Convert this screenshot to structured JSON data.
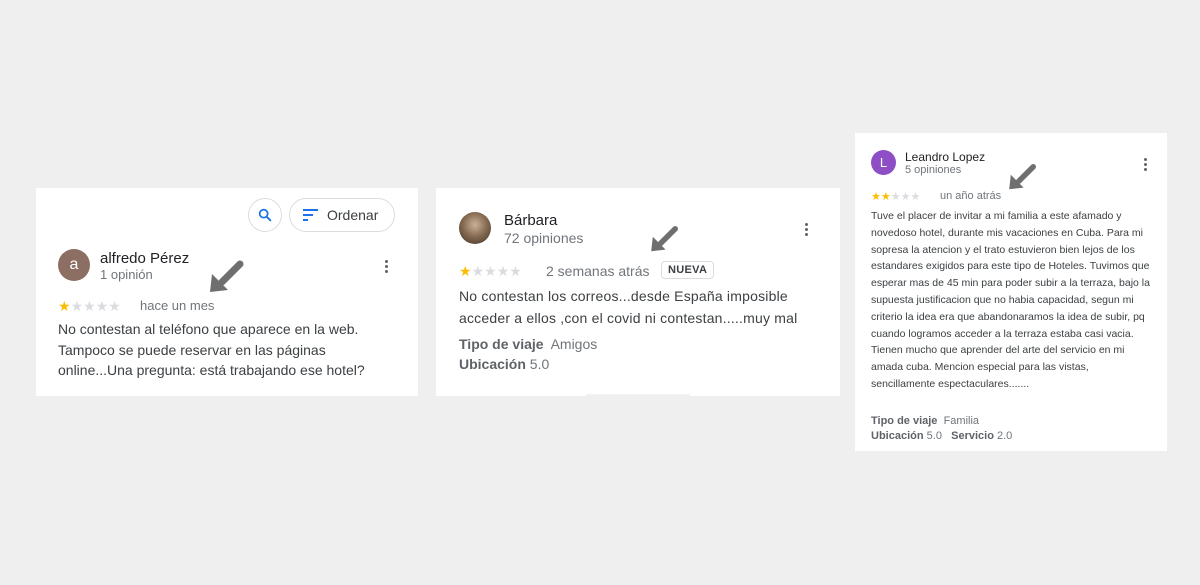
{
  "colors": {
    "star_on": "#fbbc04",
    "star_off": "#dadce0",
    "accent": "#1a73e8",
    "arrow": "#6f6f6f"
  },
  "toolbar": {
    "search_icon": "search-icon",
    "sort_icon": "sort-lines-icon",
    "sort_label": "Ordenar"
  },
  "reviews": [
    {
      "avatar_letter": "a",
      "avatar_color": "#8d6e63",
      "name": "alfredo Pérez",
      "count": "1 opinión",
      "rating": 1,
      "max_rating": 5,
      "time": "hace un mes",
      "text": "No contestan al teléfono que aparece en la web. Tampoco se puede reservar en las páginas online...Una pregunta: está trabajando ese hotel?"
    },
    {
      "avatar_letter": "",
      "avatar_color": "#6d5a4b",
      "name": "Bárbara",
      "count": "72 opiniones",
      "rating": 1,
      "max_rating": 5,
      "time": "2 semanas atrás",
      "badge": "NUEVA",
      "text": "No contestan los correos...desde España imposible acceder a ellos ,con el covid ni contestan.....muy mal",
      "trip_label": "Tipo de viaje",
      "trip_value": "Amigos",
      "location_label": "Ubicación",
      "location_value": "5.0"
    },
    {
      "avatar_letter": "L",
      "avatar_color": "#8e4fc6",
      "name": "Leandro Lopez",
      "count": "5 opiniones",
      "rating": 2,
      "max_rating": 5,
      "time": "un año atrás",
      "text": "Tuve el placer de invitar a mi familia a este afamado y novedoso hotel, durante mis vacaciones en Cuba. Para mi sopresa la atencion y el trato estuvieron bien lejos de los estandares exigidos para este tipo de Hoteles. Tuvimos que esperar mas de 45 min para poder subir a la terraza, bajo la supuesta justificacion que no habia capacidad, segun mi criterio la idea era que abandonaramos la idea de subir, pq cuando logramos acceder a la terraza estaba casi vacia. Tienen mucho que aprender del arte del servicio en mi amada cuba. Mencion especial para las vistas, sencillamente espectaculares.......",
      "trip_label": "Tipo de viaje",
      "trip_value": "Familia",
      "location_label": "Ubicación",
      "location_value": "5.0",
      "service_label": "Servicio",
      "service_value": "2.0"
    }
  ]
}
